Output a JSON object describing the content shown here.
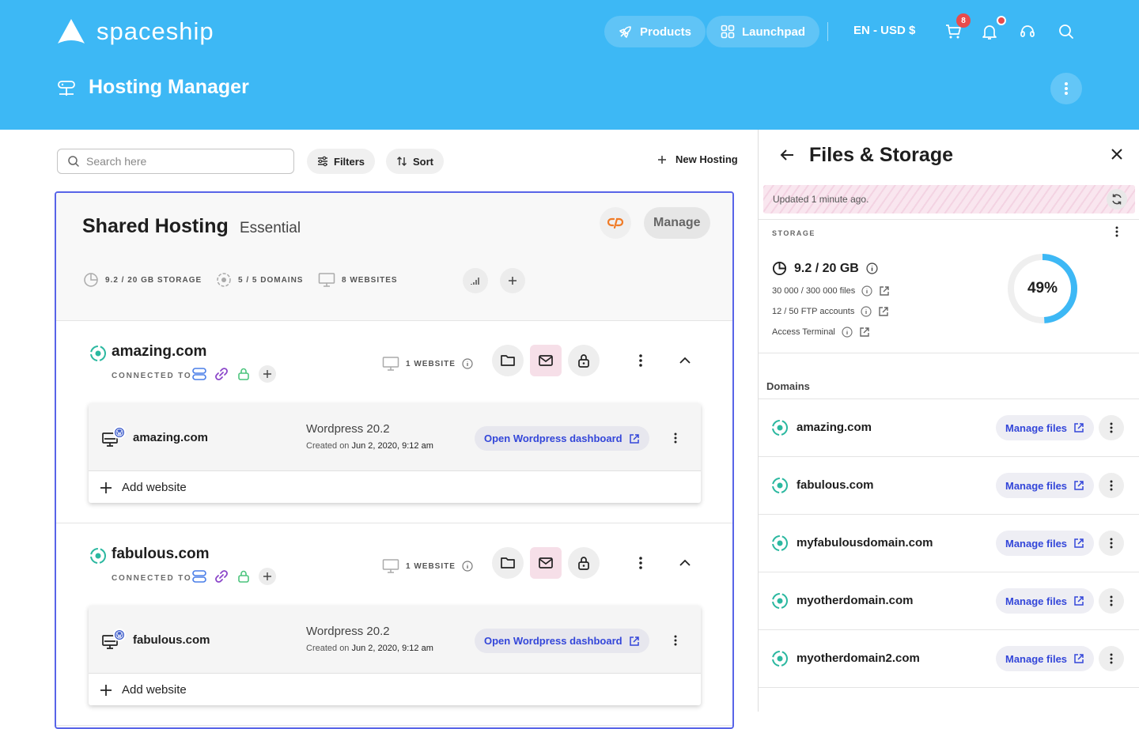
{
  "header": {
    "logo_text": "spaceship",
    "products_label": "Products",
    "launchpad_label": "Launchpad",
    "lang_currency": "EN - USD $",
    "cart_count": "8",
    "page_title": "Hosting Manager"
  },
  "toolbar": {
    "search_placeholder": "Search here",
    "filters_label": "Filters",
    "sort_label": "Sort",
    "new_hosting_label": "New Hosting"
  },
  "hosting": {
    "title": "Shared Hosting",
    "plan": "Essential",
    "manage_label": "Manage",
    "stats": {
      "storage": "9.2 / 20 GB STORAGE",
      "domains": "5 / 5 DOMAINS",
      "websites": "8 WEBSITES"
    },
    "domains": [
      {
        "name": "amazing.com",
        "connected_label": "CONNECTED TO",
        "websites_count": "1 WEBSITE",
        "website": {
          "name": "amazing.com",
          "version": "Wordpress 20.2",
          "created_prefix": "Created on",
          "created_date": "Jun 2, 2020, 9:12 am",
          "open_label": "Open Wordpress dashboard"
        },
        "add_website_label": "Add website"
      },
      {
        "name": "fabulous.com",
        "connected_label": "CONNECTED TO",
        "websites_count": "1 WEBSITE",
        "website": {
          "name": "fabulous.com",
          "version": "Wordpress 20.2",
          "created_prefix": "Created on",
          "created_date": "Jun 2, 2020, 9:12 am",
          "open_label": "Open Wordpress dashboard"
        },
        "add_website_label": "Add website"
      }
    ]
  },
  "panel": {
    "title": "Files & Storage",
    "updated_text": "Updated 1 minute ago.",
    "storage_label": "STORAGE",
    "storage_value": "9.2 / 20 GB",
    "files": "30 000 / 300 000 files",
    "ftp": "12 / 50 FTP accounts",
    "terminal": "Access Terminal",
    "usage_percent": 49,
    "usage_text": "49%",
    "domains_heading": "Domains",
    "manage_files_label": "Manage files",
    "domains": [
      {
        "name": "amazing.com"
      },
      {
        "name": "fabulous.com"
      },
      {
        "name": "myfabulousdomain.com"
      },
      {
        "name": "myotherdomain.com"
      },
      {
        "name": "myotherdomain2.com"
      }
    ]
  },
  "colors": {
    "header_bg": "#3db8f5",
    "accent": "#3346d9",
    "card_border": "#5864e8",
    "domain_icon": "#2bb8a0",
    "badge": "#e84b4b"
  }
}
